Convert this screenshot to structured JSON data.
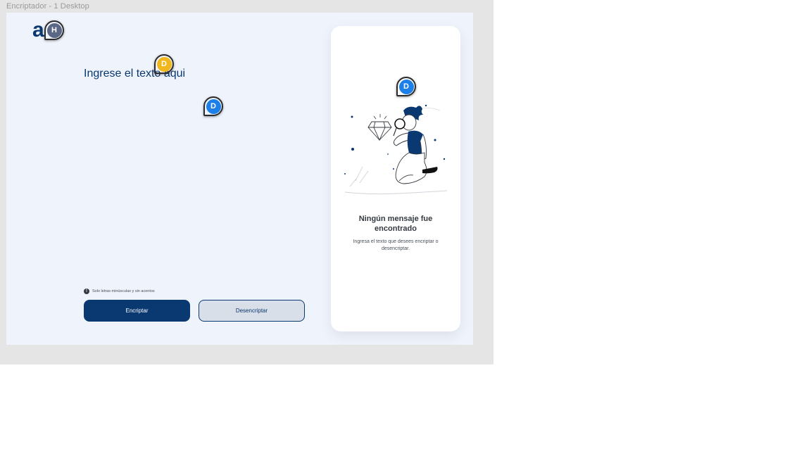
{
  "frame": {
    "title": "Encriptador - 1 Desktop"
  },
  "logo": {
    "text": "a"
  },
  "input": {
    "placeholder": "Ingrese el texto aqui"
  },
  "hint": {
    "icon": "info-icon",
    "text": "Solo letras minúsculas y sin acentos"
  },
  "buttons": {
    "encrypt": "Encriptar",
    "decrypt": "Desencriptar"
  },
  "output": {
    "title": "Ningún mensaje fue encontrado",
    "subtitle": "Ingresa el texto que desees encriptar o desencriptar."
  },
  "collaborators": [
    {
      "initial": "H",
      "color": "#5a6785"
    },
    {
      "initial": "D",
      "color": "#f0b81c"
    },
    {
      "initial": "D",
      "color": "#1d80e8"
    },
    {
      "initial": "D",
      "color": "#1d80e8"
    }
  ],
  "colors": {
    "brand": "#0a3871",
    "frame_bg": "#eff3fb",
    "secondary_btn": "#d8dfe8"
  }
}
